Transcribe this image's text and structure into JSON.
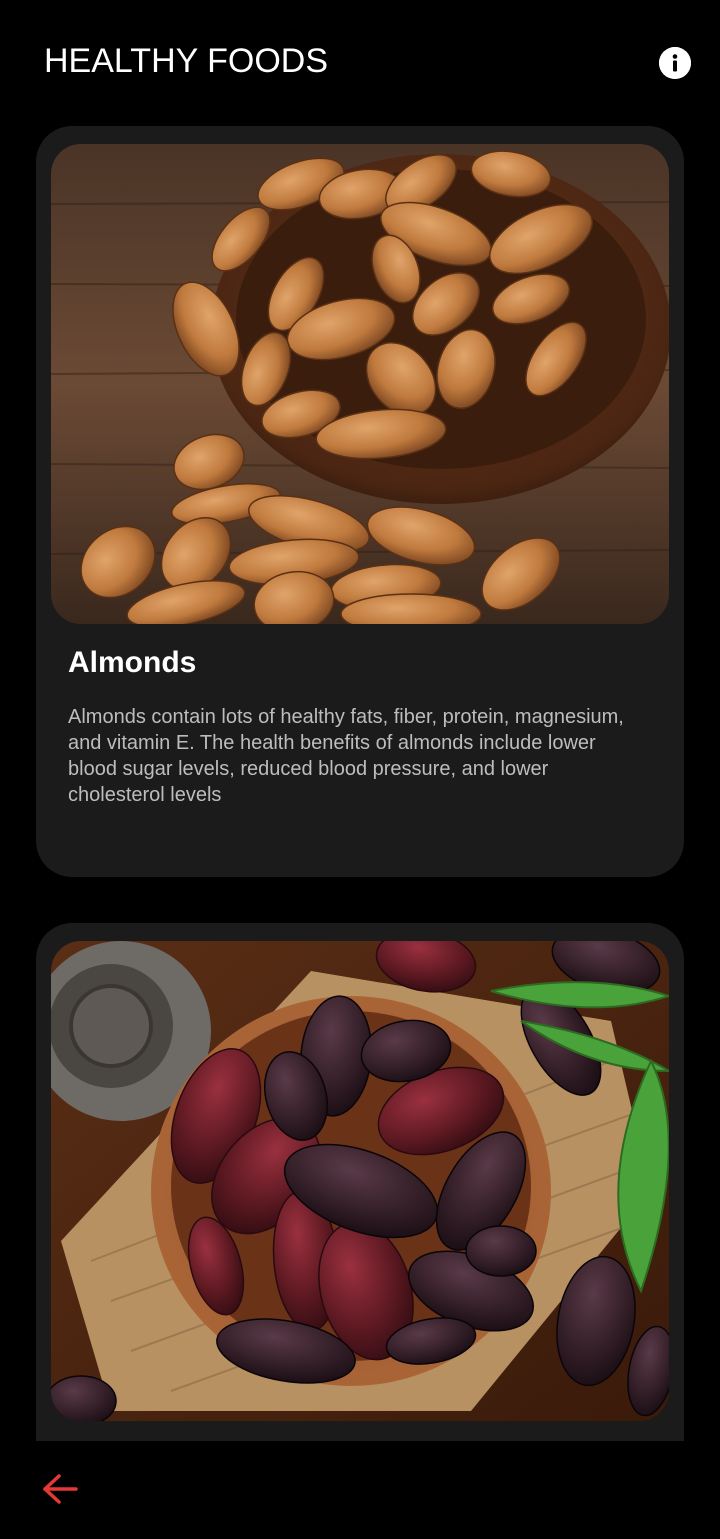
{
  "header": {
    "title": "HEALTHY FOODS",
    "info_icon": "info-circle-icon"
  },
  "cards": [
    {
      "title": "Almonds",
      "description": "Almonds contain lots of healthy fats, fiber, protein, magnesium, and vitamin E. The health benefits of almonds include lower blood sugar levels, reduced blood pressure, and lower cholesterol levels",
      "image": "almonds-in-wooden-bowl"
    },
    {
      "title": "",
      "description": "",
      "image": "dates-in-wooden-bowl"
    }
  ],
  "bottom_bar": {
    "back_icon": "arrow-left-icon"
  },
  "colors": {
    "background": "#000000",
    "card": "#1b1b1b",
    "accent_back_arrow": "#e53935",
    "title_text": "#ffffff",
    "body_text": "#bdbdbd"
  }
}
